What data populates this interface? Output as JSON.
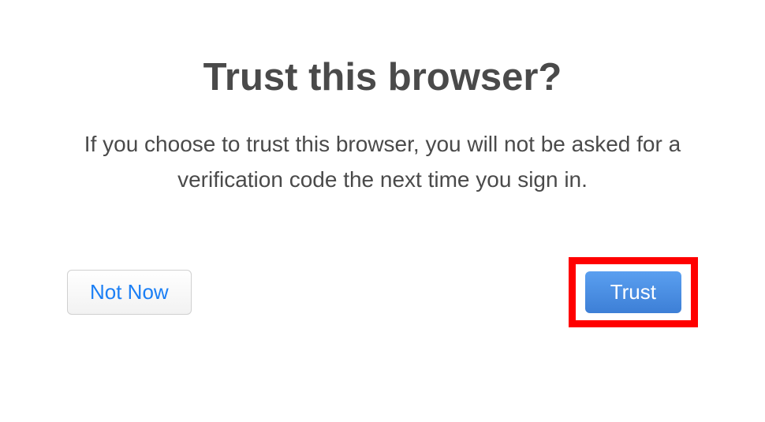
{
  "dialog": {
    "title": "Trust this browser?",
    "description": "If you choose to trust this browser, you will not be asked for a verification code the next time you sign in.",
    "buttons": {
      "not_now": "Not Now",
      "trust": "Trust"
    }
  },
  "highlight": {
    "color": "#ff0000"
  }
}
